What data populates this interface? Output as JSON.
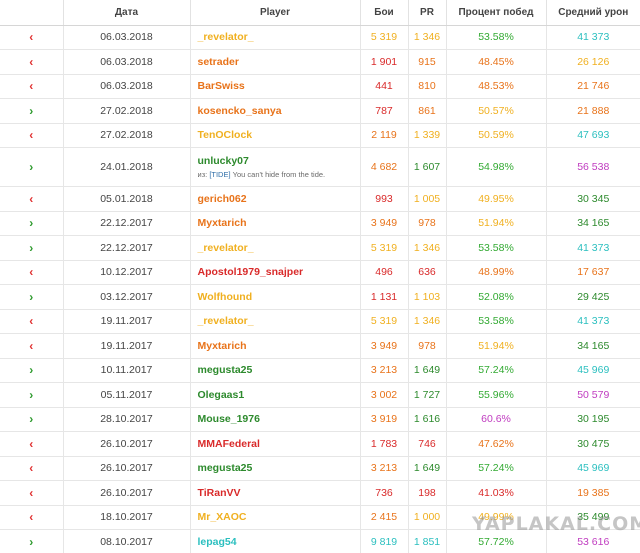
{
  "columns": [
    "",
    "Дата",
    "Player",
    "Бои",
    "PR",
    "Процент побед",
    "Средний урон"
  ],
  "clan_prefix": "из:",
  "rows": [
    {
      "dir": "in",
      "date": "06.03.2018",
      "player": "_revelator_",
      "pc": "#f0b020",
      "battles": "5 319",
      "bc": "#f0b020",
      "pr": "1 346",
      "prc": "#f0b020",
      "win": "53.58%",
      "wc": "#33aa33",
      "dmg": "41 373",
      "dc": "#2bbfbf"
    },
    {
      "dir": "in",
      "date": "06.03.2018",
      "player": "setrader",
      "pc": "#e8731a",
      "battles": "1 901",
      "bc": "#d92a2a",
      "pr": "915",
      "prc": "#e8731a",
      "win": "48.45%",
      "wc": "#e8731a",
      "dmg": "26 126",
      "dc": "#f0b020"
    },
    {
      "dir": "in",
      "date": "06.03.2018",
      "player": "BarSwiss",
      "pc": "#e8731a",
      "battles": "441",
      "bc": "#d92a2a",
      "pr": "810",
      "prc": "#e8731a",
      "win": "48.53%",
      "wc": "#e8731a",
      "dmg": "21 746",
      "dc": "#e8731a"
    },
    {
      "dir": "out",
      "date": "27.02.2018",
      "player": "kosencko_sanya",
      "pc": "#e8731a",
      "battles": "787",
      "bc": "#d92a2a",
      "pr": "861",
      "prc": "#e8731a",
      "win": "50.57%",
      "wc": "#f0b020",
      "dmg": "21 888",
      "dc": "#e8731a"
    },
    {
      "dir": "in",
      "date": "27.02.2018",
      "player": "TenOClock",
      "pc": "#f0b020",
      "battles": "2 119",
      "bc": "#e8731a",
      "pr": "1 339",
      "prc": "#f0b020",
      "win": "50.59%",
      "wc": "#f0b020",
      "dmg": "47 693",
      "dc": "#2bbfbf"
    },
    {
      "dir": "out",
      "date": "24.01.2018",
      "player": "unlucky07",
      "pc": "#2d8a2d",
      "battles": "4 682",
      "bc": "#e8731a",
      "pr": "1 607",
      "prc": "#2d8a2d",
      "win": "54.98%",
      "wc": "#33aa33",
      "dmg": "56 538",
      "dc": "#c03cc0",
      "clan_tag": "[TIDE]",
      "clan_name": " You can't hide from the tide."
    },
    {
      "dir": "in",
      "date": "05.01.2018",
      "player": "gerich062",
      "pc": "#e8731a",
      "battles": "993",
      "bc": "#d92a2a",
      "pr": "1 005",
      "prc": "#f0b020",
      "win": "49.95%",
      "wc": "#f0b020",
      "dmg": "30 345",
      "dc": "#2d8a2d"
    },
    {
      "dir": "out",
      "date": "22.12.2017",
      "player": "Myxtarich",
      "pc": "#e8731a",
      "battles": "3 949",
      "bc": "#e8731a",
      "pr": "978",
      "prc": "#e8731a",
      "win": "51.94%",
      "wc": "#f0b020",
      "dmg": "34 165",
      "dc": "#2d8a2d"
    },
    {
      "dir": "out",
      "date": "22.12.2017",
      "player": "_revelator_",
      "pc": "#f0b020",
      "battles": "5 319",
      "bc": "#f0b020",
      "pr": "1 346",
      "prc": "#f0b020",
      "win": "53.58%",
      "wc": "#33aa33",
      "dmg": "41 373",
      "dc": "#2bbfbf"
    },
    {
      "dir": "in",
      "date": "10.12.2017",
      "player": "Apostol1979_snajper",
      "pc": "#d92a2a",
      "battles": "496",
      "bc": "#d92a2a",
      "pr": "636",
      "prc": "#d92a2a",
      "win": "48.99%",
      "wc": "#e8731a",
      "dmg": "17 637",
      "dc": "#e8731a"
    },
    {
      "dir": "out",
      "date": "03.12.2017",
      "player": "Wolfhound",
      "pc": "#f0b020",
      "battles": "1 131",
      "bc": "#d92a2a",
      "pr": "1 103",
      "prc": "#f0b020",
      "win": "52.08%",
      "wc": "#33aa33",
      "dmg": "29 425",
      "dc": "#2d8a2d"
    },
    {
      "dir": "in",
      "date": "19.11.2017",
      "player": "_revelator_",
      "pc": "#f0b020",
      "battles": "5 319",
      "bc": "#f0b020",
      "pr": "1 346",
      "prc": "#f0b020",
      "win": "53.58%",
      "wc": "#33aa33",
      "dmg": "41 373",
      "dc": "#2bbfbf"
    },
    {
      "dir": "in",
      "date": "19.11.2017",
      "player": "Myxtarich",
      "pc": "#e8731a",
      "battles": "3 949",
      "bc": "#e8731a",
      "pr": "978",
      "prc": "#e8731a",
      "win": "51.94%",
      "wc": "#f0b020",
      "dmg": "34 165",
      "dc": "#2d8a2d"
    },
    {
      "dir": "out",
      "date": "10.11.2017",
      "player": "megusta25",
      "pc": "#2d8a2d",
      "battles": "3 213",
      "bc": "#e8731a",
      "pr": "1 649",
      "prc": "#2d8a2d",
      "win": "57.24%",
      "wc": "#33aa33",
      "dmg": "45 969",
      "dc": "#2bbfbf"
    },
    {
      "dir": "out",
      "date": "05.11.2017",
      "player": "Olegaas1",
      "pc": "#2d8a2d",
      "battles": "3 002",
      "bc": "#e8731a",
      "pr": "1 727",
      "prc": "#2d8a2d",
      "win": "55.96%",
      "wc": "#33aa33",
      "dmg": "50 579",
      "dc": "#c03cc0"
    },
    {
      "dir": "out",
      "date": "28.10.2017",
      "player": "Mouse_1976",
      "pc": "#2d8a2d",
      "battles": "3 919",
      "bc": "#e8731a",
      "pr": "1 616",
      "prc": "#2d8a2d",
      "win": "60.6%",
      "wc": "#c03cc0",
      "dmg": "30 195",
      "dc": "#2d8a2d"
    },
    {
      "dir": "in",
      "date": "26.10.2017",
      "player": "MMAFederal",
      "pc": "#d92a2a",
      "battles": "1 783",
      "bc": "#d92a2a",
      "pr": "746",
      "prc": "#d92a2a",
      "win": "47.62%",
      "wc": "#e8731a",
      "dmg": "30 475",
      "dc": "#2d8a2d"
    },
    {
      "dir": "in",
      "date": "26.10.2017",
      "player": "megusta25",
      "pc": "#2d8a2d",
      "battles": "3 213",
      "bc": "#e8731a",
      "pr": "1 649",
      "prc": "#2d8a2d",
      "win": "57.24%",
      "wc": "#33aa33",
      "dmg": "45 969",
      "dc": "#2bbfbf"
    },
    {
      "dir": "in",
      "date": "26.10.2017",
      "player": "TiRanVV",
      "pc": "#d92a2a",
      "battles": "736",
      "bc": "#d92a2a",
      "pr": "198",
      "prc": "#d92a2a",
      "win": "41.03%",
      "wc": "#d92a2a",
      "dmg": "19 385",
      "dc": "#e8731a"
    },
    {
      "dir": "in",
      "date": "18.10.2017",
      "player": "Mr_XAOC",
      "pc": "#f0b020",
      "battles": "2 415",
      "bc": "#e8731a",
      "pr": "1 000",
      "prc": "#f0b020",
      "win": "49.99%",
      "wc": "#f0b020",
      "dmg": "35 499",
      "dc": "#2d8a2d"
    },
    {
      "dir": "out",
      "date": "08.10.2017",
      "player": "lepag54",
      "pc": "#2bbfbf",
      "battles": "9 819",
      "bc": "#2bbfbf",
      "pr": "1 851",
      "prc": "#2bbfbf",
      "win": "57.72%",
      "wc": "#33aa33",
      "dmg": "53 616",
      "dc": "#c03cc0"
    }
  ],
  "watermark": "YAPLAKAL.COM",
  "icons": {
    "in": "chevron-left-icon",
    "out": "chevron-right-icon"
  }
}
